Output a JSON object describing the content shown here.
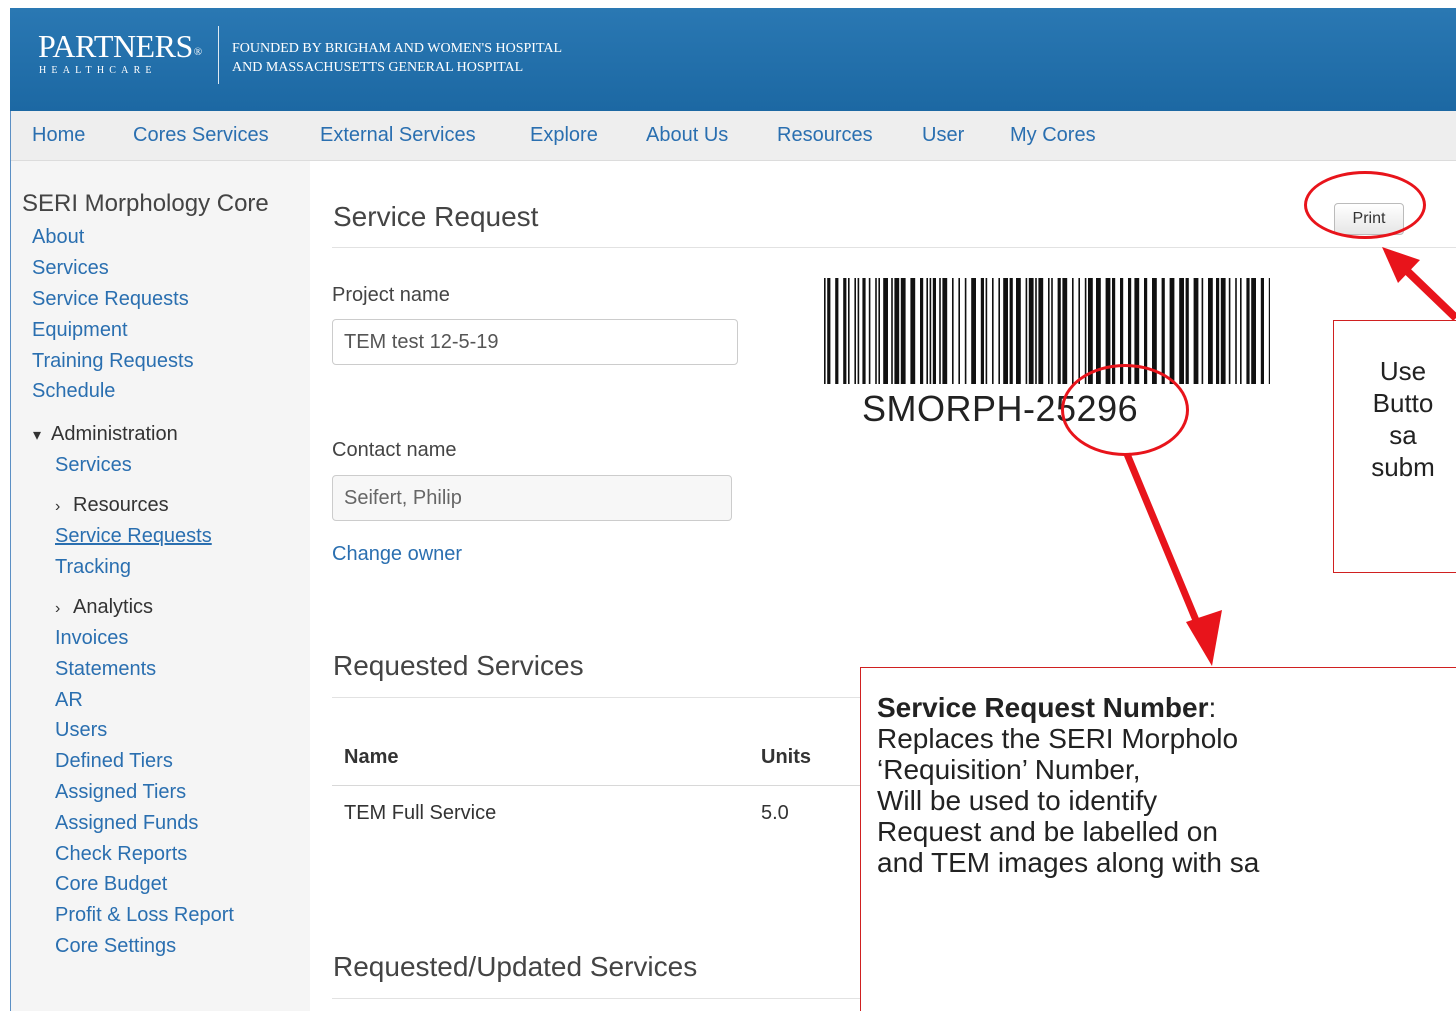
{
  "header": {
    "logo_main": "PARTNERS",
    "logo_reg": "®",
    "logo_sub": "HEALTHCARE",
    "tagline_line1": "FOUNDED BY BRIGHAM AND WOMEN'S HOSPITAL",
    "tagline_line2": "AND MASSACHUSETTS GENERAL HOSPITAL"
  },
  "nav": [
    "Home",
    "Cores Services",
    "External Services",
    "Explore",
    "About Us",
    "Resources",
    "User",
    "My Cores"
  ],
  "sidebar": {
    "core_name": "SERI Morphology Core",
    "links": [
      "About",
      "Services",
      "Service Requests",
      "Equipment",
      "Training Requests",
      "Schedule"
    ],
    "admin_label": "Administration",
    "admin_services": "Services",
    "resources_label": "Resources",
    "resources_links": [
      "Service Requests",
      "Tracking"
    ],
    "analytics_label": "Analytics",
    "analytics_links": [
      "Invoices",
      "Statements",
      "AR",
      "Users",
      "Defined Tiers",
      "Assigned Tiers",
      "Assigned Funds",
      "Check Reports",
      "Core Budget",
      "Profit & Loss Report",
      "Core Settings"
    ]
  },
  "main": {
    "title": "Service Request",
    "print_label": "Print",
    "project_label": "Project name",
    "project_value": "TEM test 12-5-19",
    "contact_label": "Contact name",
    "contact_value": "Seifert, Philip",
    "change_owner": "Change owner",
    "barcode_text": "SMORPH-25296",
    "requested_title": "Requested Services",
    "table_headers": [
      "Name",
      "Units"
    ],
    "table_rows": [
      [
        "TEM Full Service",
        "5.0"
      ]
    ],
    "updated_title": "Requested/Updated Services"
  },
  "annotations": {
    "print_callout": [
      "Use",
      "Butto",
      "sa",
      "subm"
    ],
    "sr_callout_title": "Service Request Number",
    "sr_callout_colon": ":",
    "sr_callout_lines": [
      "Replaces the SERI Morpholo",
      "‘Requisition’ Number,",
      "Will be used to identify",
      "Request and be labelled on",
      "and TEM images along with sa"
    ],
    "color_red": "#e8141b"
  }
}
